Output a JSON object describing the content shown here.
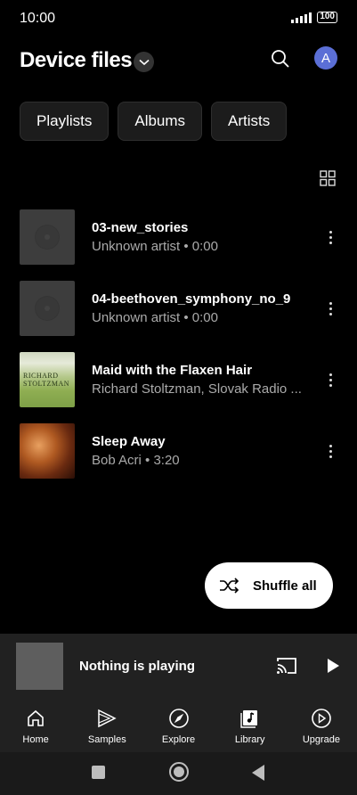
{
  "status_bar": {
    "time": "10:00",
    "battery": "100"
  },
  "header": {
    "title": "Device files",
    "avatar_letter": "A"
  },
  "chips": [
    {
      "label": "Playlists"
    },
    {
      "label": "Albums"
    },
    {
      "label": "Artists"
    }
  ],
  "songs": [
    {
      "title": "03-new_stories",
      "subtitle": "Unknown artist • 0:00",
      "art": "placeholder"
    },
    {
      "title": "04-beethoven_symphony_no_9",
      "subtitle": "Unknown artist • 0:00",
      "art": "placeholder"
    },
    {
      "title": "Maid with the Flaxen Hair",
      "subtitle": "Richard Stoltzman, Slovak Radio ...",
      "art": "album-art",
      "art_text": "RICHARD STOLTZMAN"
    },
    {
      "title": "Sleep Away",
      "subtitle": "Bob Acri • 3:20",
      "art": "album-art"
    }
  ],
  "shuffle": {
    "label": "Shuffle all"
  },
  "mini_player": {
    "title": "Nothing is playing"
  },
  "bottom_nav": [
    {
      "label": "Home",
      "icon": "home-icon"
    },
    {
      "label": "Samples",
      "icon": "samples-icon"
    },
    {
      "label": "Explore",
      "icon": "compass-icon"
    },
    {
      "label": "Library",
      "icon": "library-icon"
    },
    {
      "label": "Upgrade",
      "icon": "upgrade-icon"
    }
  ],
  "colors": {
    "background": "#000000",
    "surface": "#212121",
    "avatar": "#5b6fd6",
    "chip": "#1c1c1c"
  }
}
